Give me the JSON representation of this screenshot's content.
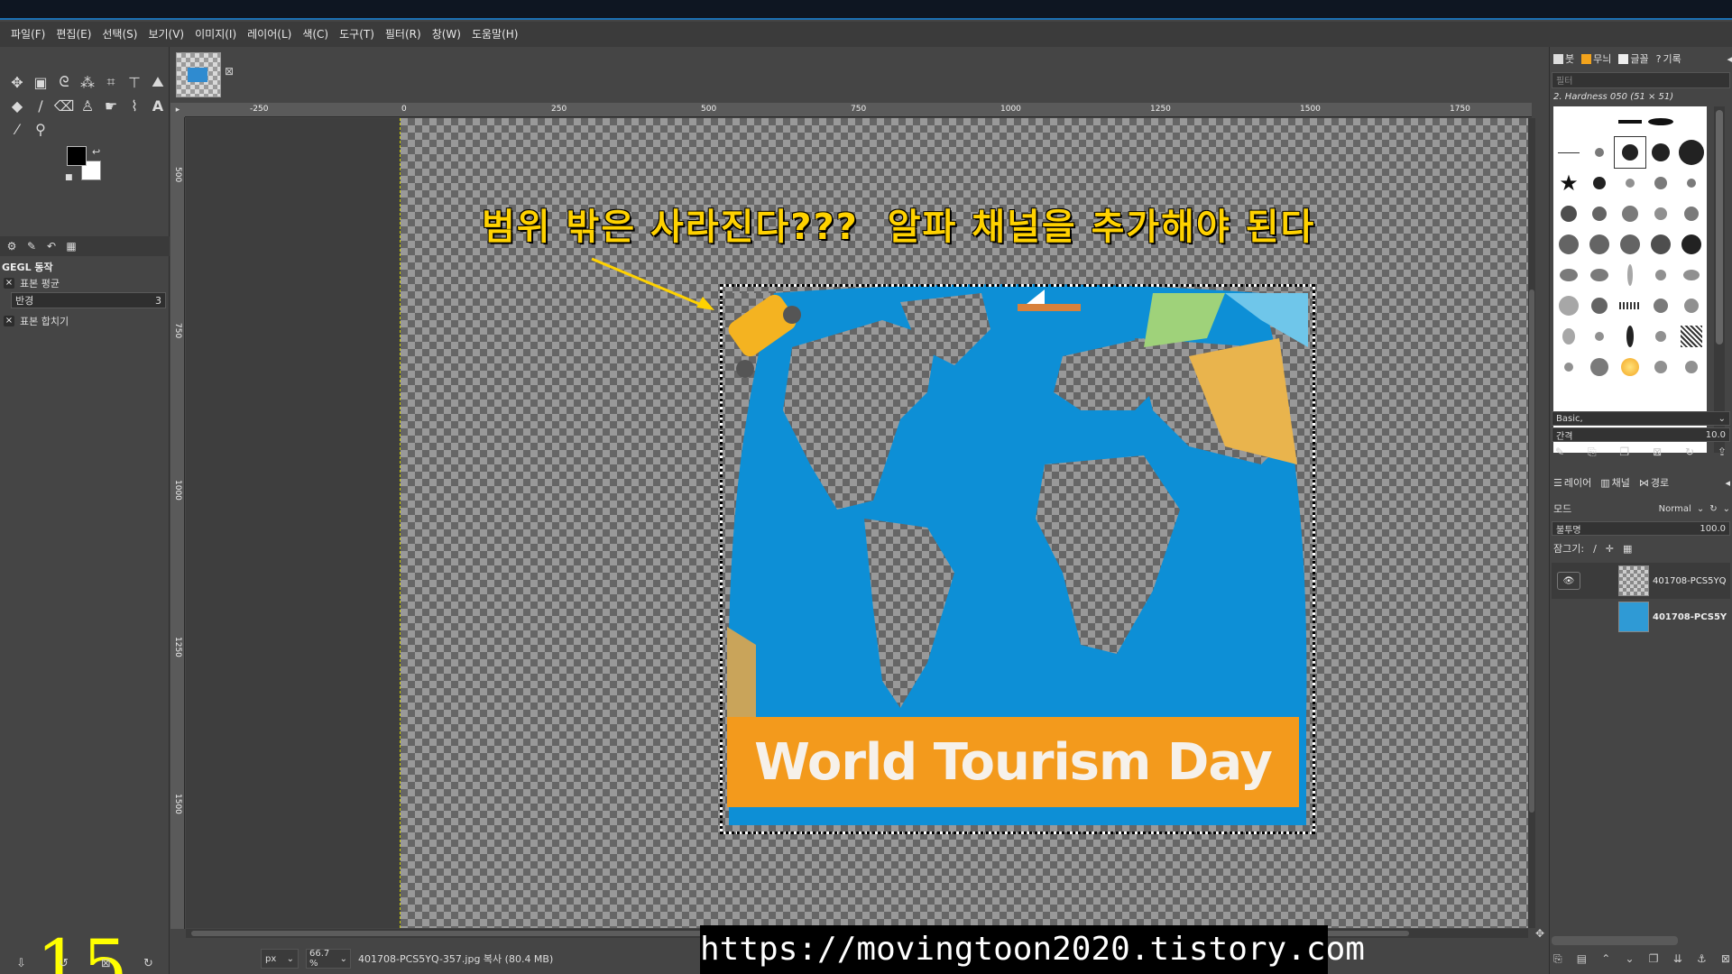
{
  "menubar": [
    "파일(F)",
    "편집(E)",
    "선택(S)",
    "보기(V)",
    "이미지(I)",
    "레이어(L)",
    "색(C)",
    "도구(T)",
    "필터(R)",
    "창(W)",
    "도움말(H)"
  ],
  "tools": [
    "move-icon",
    "rect-select-icon",
    "lasso-icon",
    "fuzzy-select-icon",
    "crop-icon",
    "transform-icon",
    "warp-icon",
    "bucket-icon",
    "paintbrush-icon",
    "eraser-icon",
    "clone-icon",
    "smudge-icon",
    "paths-icon",
    "text-icon",
    "color-picker-icon",
    "zoom-icon"
  ],
  "tool_options": {
    "title": "GEGL 동작",
    "sample_average": "표본 평균",
    "radius_label": "반경",
    "radius_value": "3",
    "sample_merged": "표본 합치기"
  },
  "step_number": "15",
  "ruler": {
    "h_ticks": [
      "-250",
      "0",
      "250",
      "500",
      "750",
      "1000",
      "1250",
      "1500",
      "1750"
    ],
    "v_ticks": [
      "500",
      "750",
      "1000",
      "1250",
      "1500"
    ]
  },
  "canvas": {
    "annotation": "범위 밖은 사라진다???  알파 채널을 추가해야 된다",
    "banner_text": "World Tourism Day"
  },
  "statusbar": {
    "unit": "px",
    "zoom": "66.7 %",
    "info": "401708-PCS5YQ-357.jpg 복사 (80.4 MB)"
  },
  "watermark_url": "https://movingtoon2020.tistory.com",
  "right_dock": {
    "tabs": [
      "붓",
      "무늬",
      "글꼴",
      "기록"
    ],
    "filter_placeholder": "필터",
    "brush_name": "2. Hardness 050 (51 × 51)",
    "preset": "Basic,",
    "spacing_label": "간격",
    "spacing_value": "10.0",
    "layer_tabs": [
      "레이어",
      "채널",
      "경로"
    ],
    "mode_label": "모드",
    "mode_value": "Normal",
    "opacity_label": "불투명",
    "opacity_value": "100.0",
    "lock_label": "잠그기:",
    "layers": [
      {
        "name": "401708-PCS5YQ",
        "active": true
      },
      {
        "name": "401708-PCS5Y",
        "active": false
      }
    ]
  },
  "colors": {
    "annotation": "#ffd200",
    "banner": "#f39a1c",
    "ocean": "#0d8fd6"
  }
}
